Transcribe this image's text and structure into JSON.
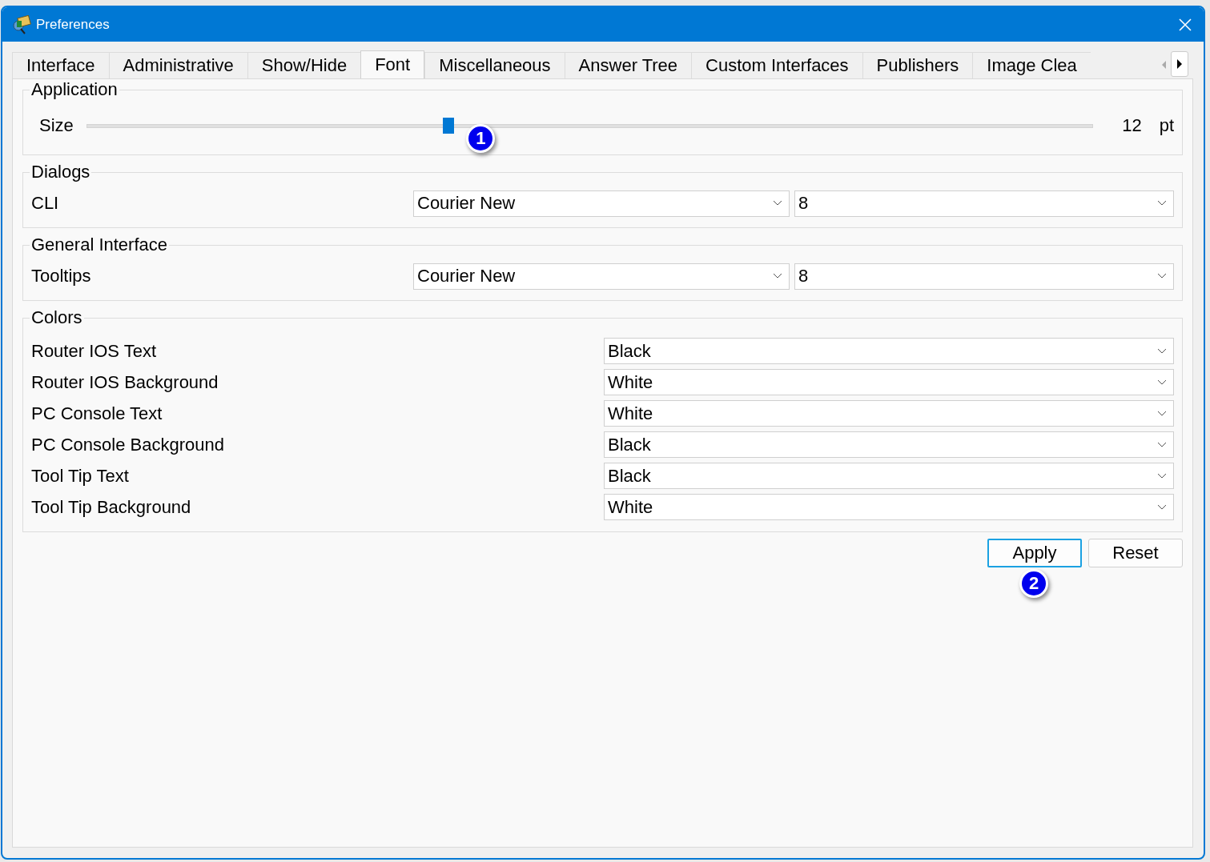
{
  "window": {
    "title": "Preferences"
  },
  "tabs": [
    {
      "label": "Interface",
      "selected": false
    },
    {
      "label": "Administrative",
      "selected": false
    },
    {
      "label": "Show/Hide",
      "selected": false
    },
    {
      "label": "Font",
      "selected": true
    },
    {
      "label": "Miscellaneous",
      "selected": false
    },
    {
      "label": "Answer Tree",
      "selected": false
    },
    {
      "label": "Custom Interfaces",
      "selected": false
    },
    {
      "label": "Publishers",
      "selected": false
    },
    {
      "label": "Image Clea",
      "selected": false
    }
  ],
  "application": {
    "title": "Application",
    "size_label": "Size",
    "level": 0.36,
    "value": "12",
    "unit": "pt",
    "callout": "1"
  },
  "dialogs": {
    "title": "Dialogs",
    "rows": [
      {
        "label": "CLI",
        "font": "Courier New",
        "size": "8"
      }
    ]
  },
  "general_interface": {
    "title": "General Interface",
    "rows": [
      {
        "label": "Tooltips",
        "font": "Courier New",
        "size": "8"
      }
    ]
  },
  "colors": {
    "title": "Colors",
    "rows": [
      {
        "label": "Router IOS Text",
        "value": "Black"
      },
      {
        "label": "Router IOS Background",
        "value": "White"
      },
      {
        "label": "PC Console Text",
        "value": "White"
      },
      {
        "label": "PC Console Background",
        "value": "Black"
      },
      {
        "label": "Tool Tip Text",
        "value": "Black"
      },
      {
        "label": "Tool Tip Background",
        "value": "White"
      }
    ]
  },
  "buttons": [
    {
      "label": "Apply",
      "focused": true,
      "callout": "2"
    },
    {
      "label": "Reset",
      "focused": false
    }
  ]
}
